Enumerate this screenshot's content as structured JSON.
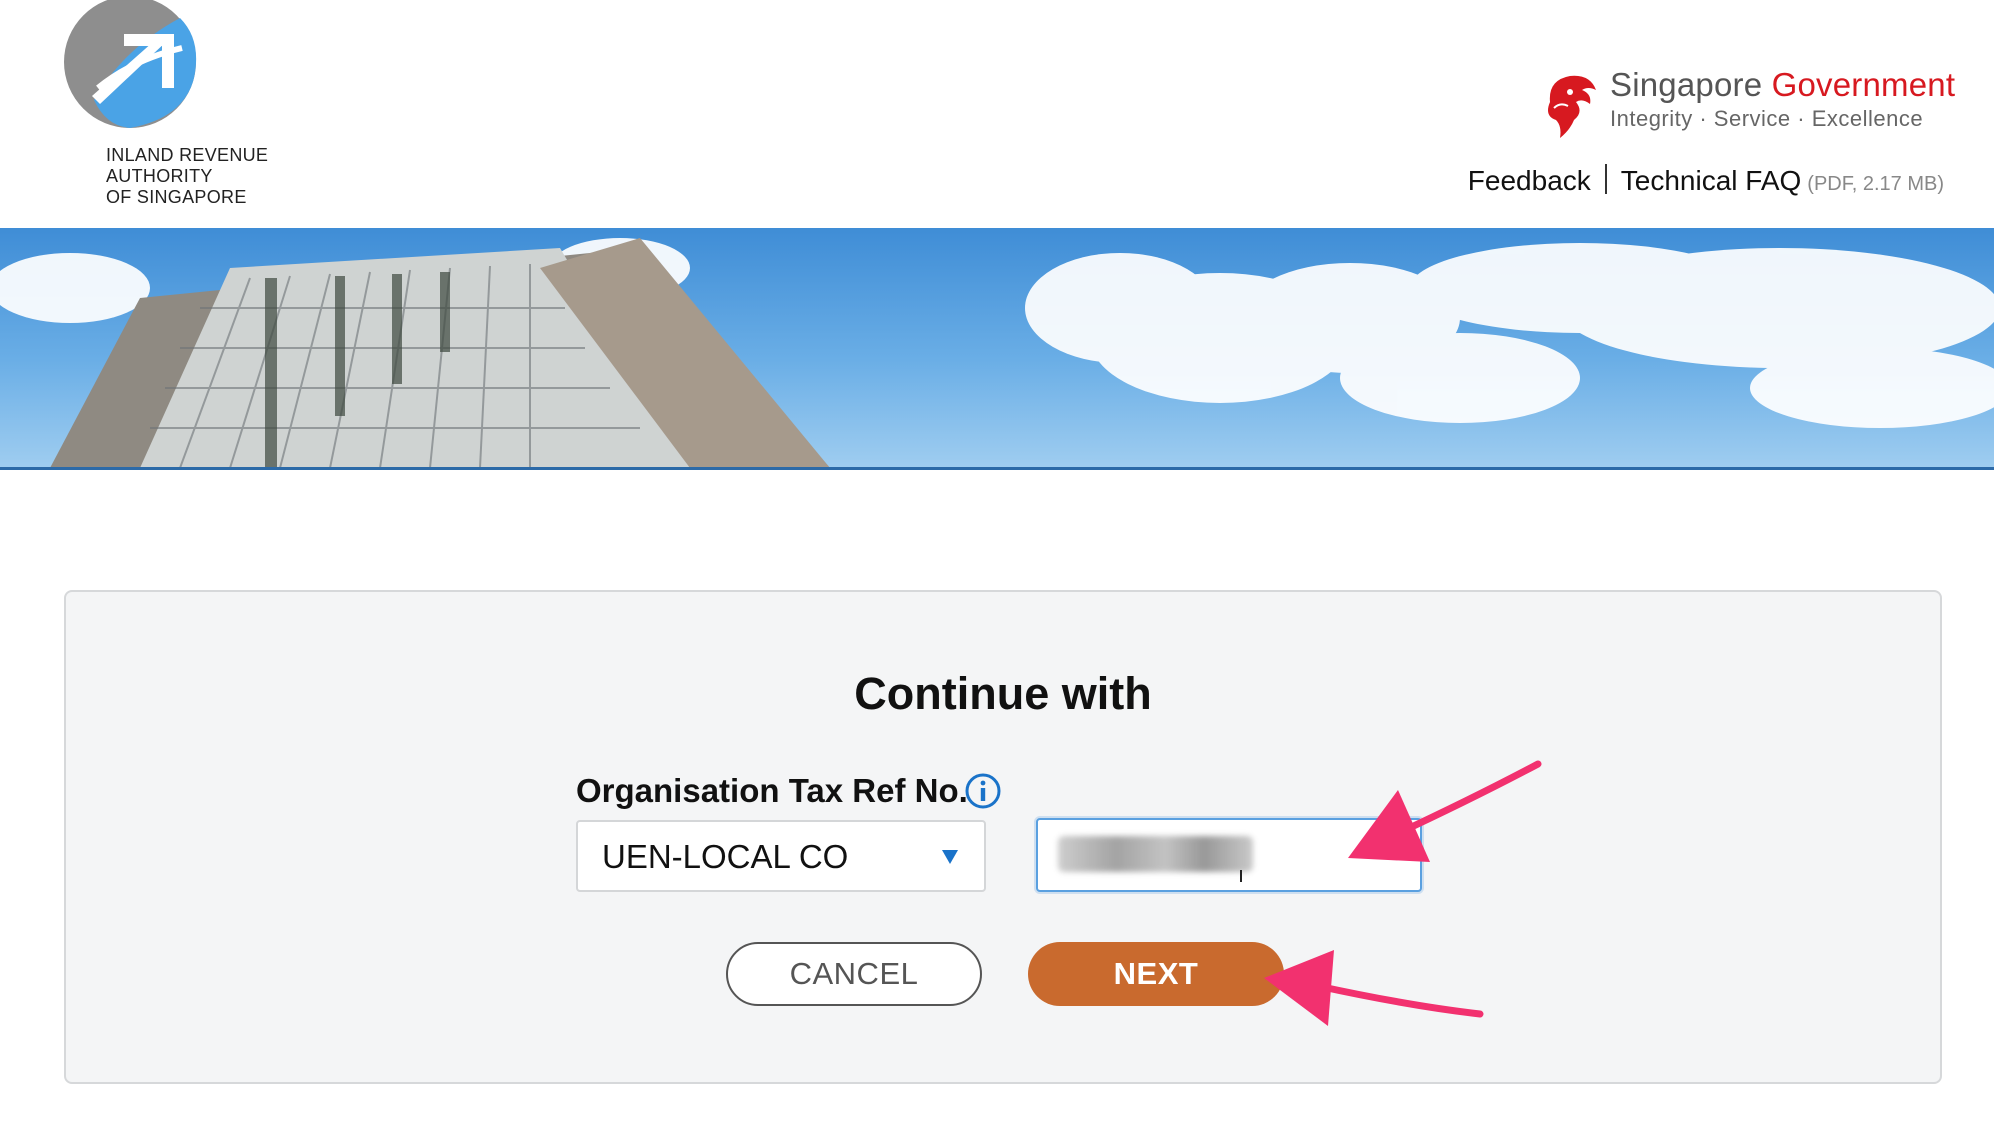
{
  "header": {
    "agency_name_lines": [
      "INLAND REVENUE",
      "AUTHORITY",
      "OF SINGAPORE"
    ],
    "gov_title_prefix": "Singapore",
    "gov_title_suffix": "Government",
    "gov_tagline": "Integrity · Service · Excellence",
    "links": {
      "feedback": "Feedback",
      "technical_faq": "Technical FAQ",
      "technical_faq_note": "(PDF, 2.17 MB)"
    }
  },
  "form": {
    "title": "Continue with",
    "field_label": "Organisation Tax Ref No.",
    "id_type_selected": "UEN-LOCAL CO",
    "cancel_label": "CANCEL",
    "next_label": "NEXT"
  },
  "colors": {
    "brand_red": "#d71920",
    "accent_blue": "#1a73c9",
    "next_button": "#c96a2e",
    "annotation_arrow": "#f2316f"
  },
  "icons": {
    "agency_logo": "iras-logo",
    "gov_logo": "merlion-lion-head-icon",
    "info": "info-icon",
    "dropdown": "caret-down-icon"
  }
}
